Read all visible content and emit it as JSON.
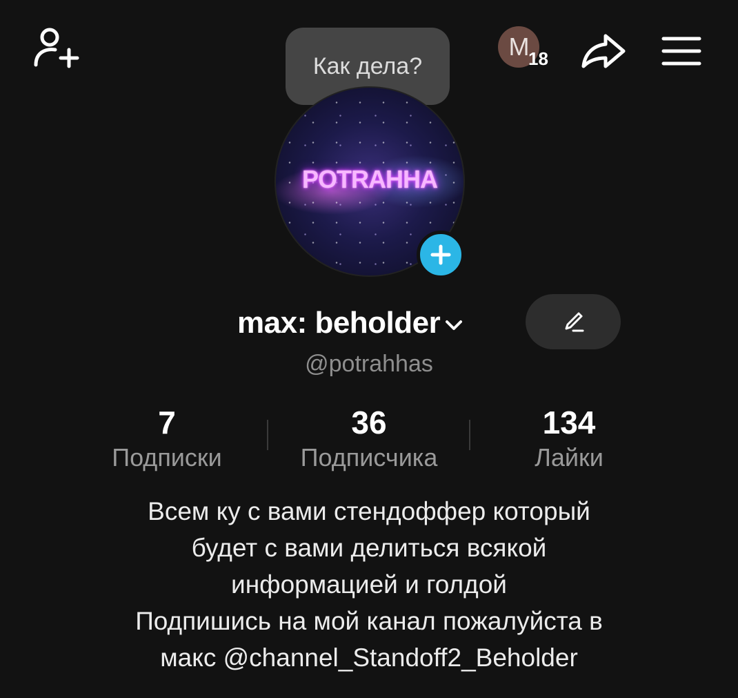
{
  "topbar": {
    "mini_avatar_letter": "M",
    "mini_avatar_count": "18"
  },
  "bubble": {
    "text": "Как дела?"
  },
  "avatar": {
    "text": "POTRAHHA"
  },
  "profile": {
    "display_name": "max: beholder",
    "handle": "@potrahhas"
  },
  "stats": [
    {
      "value": "7",
      "label": "Подписки"
    },
    {
      "value": "36",
      "label": "Подписчика"
    },
    {
      "value": "134",
      "label": "Лайки"
    }
  ],
  "bio": {
    "lines": [
      "Всем ку с вами стендоффер который",
      "будет с вами делиться всякой",
      "информацией и голдой",
      "Подпишись на мой канал пожалуйста в",
      "макс @channel_Standoff2_Beholder"
    ]
  },
  "colors": {
    "background": "#121212",
    "accent_plus": "#2bb6e6",
    "bubble": "#454545",
    "secondary_text": "#8e8e8e"
  }
}
